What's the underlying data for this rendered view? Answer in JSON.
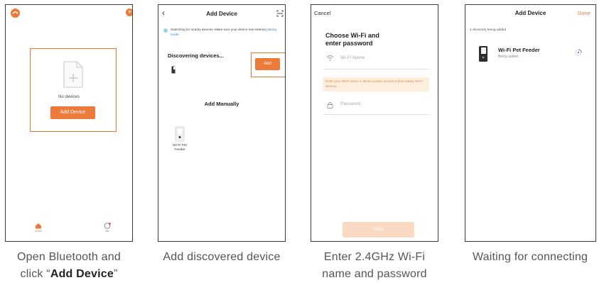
{
  "colors": {
    "accent": "#ec7a3b",
    "highlight": "#e9773a",
    "frame": "#3a3a3a",
    "caption": "#555555"
  },
  "screen1": {
    "empty_text": "No devices",
    "add_button": "Add Device",
    "tab_home": "Home",
    "tab_me": "Me",
    "caption_line1": "Open Bluetooth and",
    "caption_pre": "click “",
    "caption_bold": "Add Device",
    "caption_post": "”"
  },
  "screen2": {
    "title": "Add Device",
    "notice_text": "Searching for nearby devices. Make sure your device has entered",
    "notice_link": "pairing mode",
    "notice_end": ".",
    "discovering": "Discovering devices...",
    "add_button": "Add",
    "add_manually": "Add Manually",
    "device_label": "Wi-Fi Pet Feeder",
    "caption": "Add discovered device"
  },
  "screen3": {
    "cancel": "Cancel",
    "heading_line1": "Choose Wi-Fi and",
    "heading_line2": "enter password",
    "wifi_placeholder": "Wi-Fi Name",
    "hint": "Enter your Wi-Fi name or allow location access to find nearby Wi-Fi devices.",
    "password_placeholder": "Password",
    "next_button": "Next",
    "caption_line1": "Enter 2.4GHz Wi-Fi",
    "caption_line2": "name and password"
  },
  "screen4": {
    "title": "Add Device",
    "done": "Done",
    "count_text": "1 device(s) being added",
    "device_name": "Wi-Fi Pet Feeder",
    "device_status": "Being added",
    "caption": "Waiting for connecting"
  }
}
